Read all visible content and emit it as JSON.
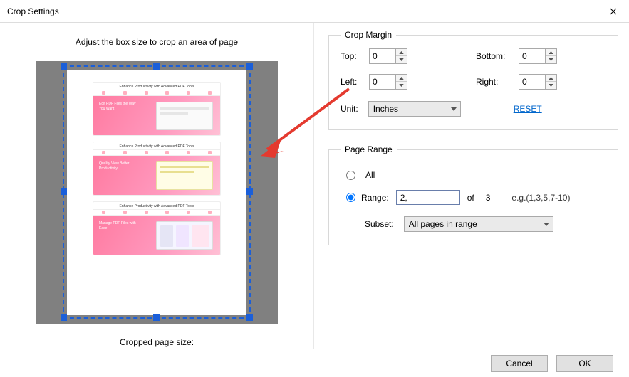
{
  "title": "Crop Settings",
  "left": {
    "instruction": "Adjust the box size to crop an area of page",
    "cropped_label": "Cropped page size:",
    "mini_heading": "Enhance Productivity with Advanced PDF Tools"
  },
  "crop_margin": {
    "legend": "Crop Margin",
    "top_label": "Top:",
    "top_value": "0",
    "bottom_label": "Bottom:",
    "bottom_value": "0",
    "left_label": "Left:",
    "left_value": "0",
    "right_label": "Right:",
    "right_value": "0",
    "unit_label": "Unit:",
    "unit_value": "Inches",
    "reset_label": "RESET"
  },
  "page_range": {
    "legend": "Page Range",
    "all_label": "All",
    "range_label": "Range:",
    "range_value": "2,",
    "of_label": "of",
    "total": "3",
    "example": "e.g.(1,3,5,7-10)",
    "subset_label": "Subset:",
    "subset_value": "All pages in range"
  },
  "footer": {
    "cancel": "Cancel",
    "ok": "OK"
  }
}
